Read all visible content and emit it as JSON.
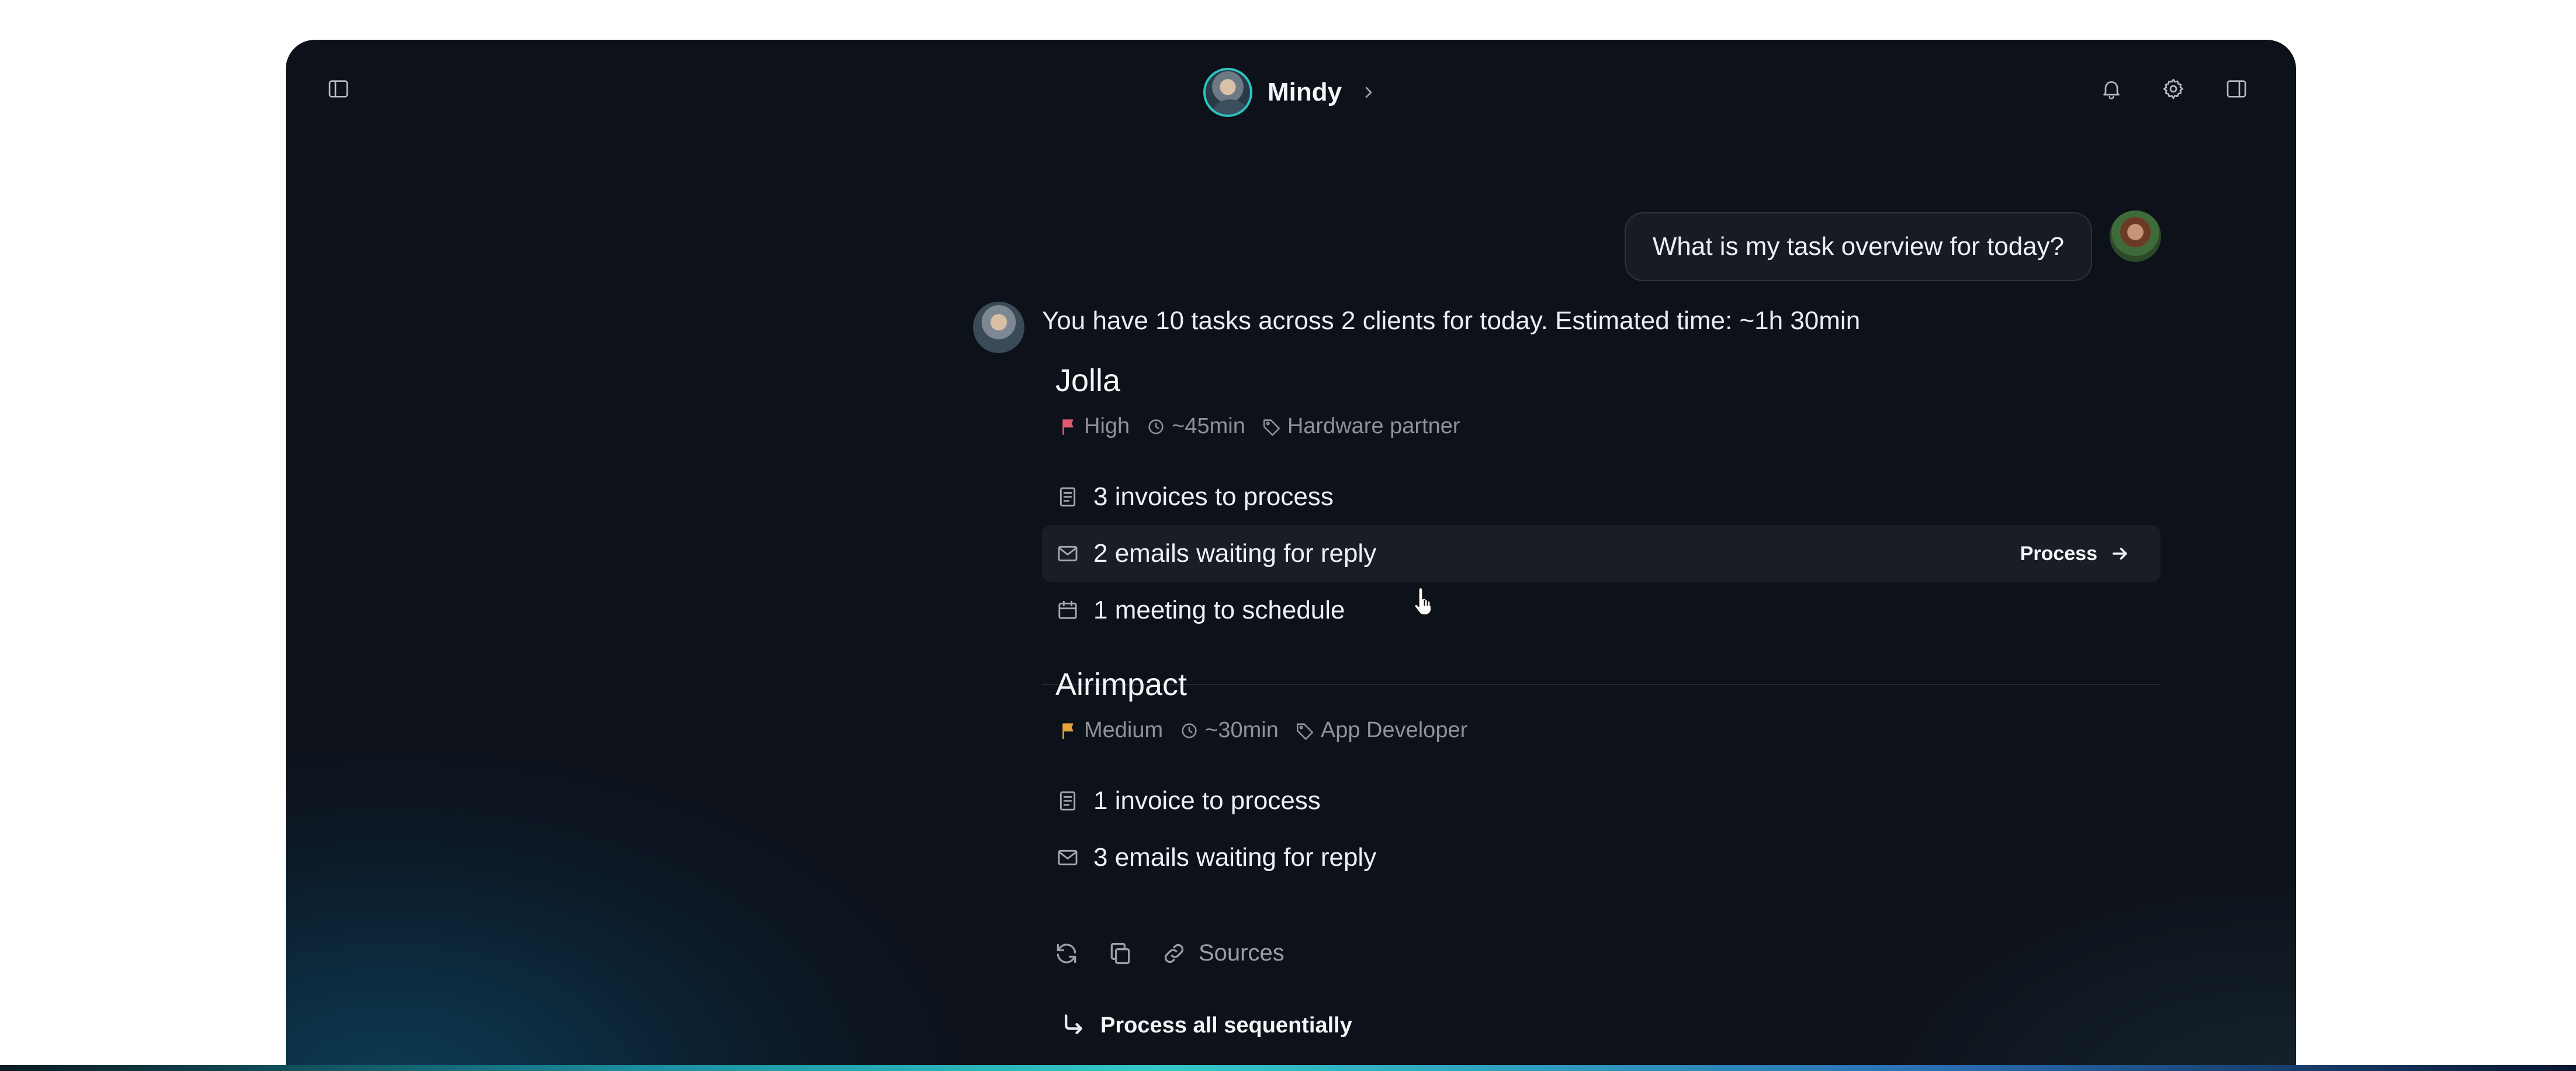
{
  "header": {
    "name": "Mindy",
    "icons": {
      "left": "sidebar-toggle-icon",
      "bell": "bell-icon",
      "settings": "gear-icon",
      "right_panel": "right-panel-icon"
    }
  },
  "conversation": {
    "user_message": "What is my task overview for today?",
    "assistant_summary": "You have 10 tasks across 2 clients for today.  Estimated time: ~1h 30min"
  },
  "clients": [
    {
      "name": "Jolla",
      "priority": "High",
      "priority_color": "#e25a6e",
      "time": "~45min",
      "tag": "Hardware partner",
      "tasks": [
        {
          "icon": "document-icon",
          "label": "3 invoices to process"
        },
        {
          "icon": "mail-icon",
          "label": "2 emails waiting for reply",
          "action": "Process"
        },
        {
          "icon": "calendar-icon",
          "label": "1 meeting to schedule"
        }
      ]
    },
    {
      "name": "Airimpact",
      "priority": "Medium",
      "priority_color": "#e9a23b",
      "time": "~30min",
      "tag": "App Developer",
      "tasks": [
        {
          "icon": "document-icon",
          "label": "1 invoice to process"
        },
        {
          "icon": "mail-icon",
          "label": "3 emails waiting for reply"
        }
      ]
    }
  ],
  "actions": {
    "sources_label": "Sources",
    "process_all_label": "Process all sequentially"
  },
  "colors": {
    "background": "#0d1119",
    "accent_teal": "#2ec4c0"
  }
}
